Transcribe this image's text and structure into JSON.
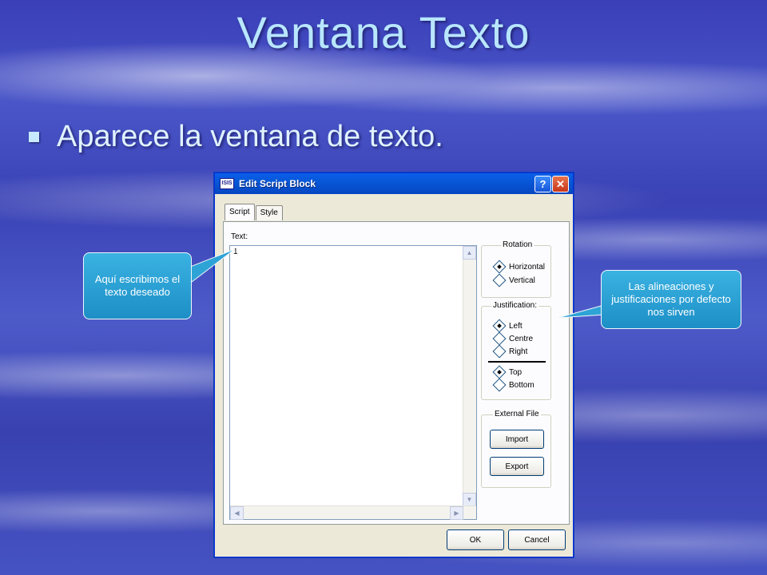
{
  "slide": {
    "title": "Ventana Texto",
    "bullet": "Aparece la ventana de texto."
  },
  "dialog": {
    "app_icon_text": "ISIS",
    "title": "Edit Script Block",
    "help_label": "?",
    "close_label": "✕",
    "tabs": [
      {
        "label": "Script",
        "active": true
      },
      {
        "label": "Style",
        "active": false
      }
    ],
    "text_label": "Text:",
    "text_value": "1",
    "rotation": {
      "title": "Rotation",
      "options": [
        {
          "label": "Horizontal",
          "checked": true
        },
        {
          "label": "Vertical",
          "checked": false
        }
      ]
    },
    "justification": {
      "title": "Justification:",
      "horizontal": [
        {
          "label": "Left",
          "checked": true
        },
        {
          "label": "Centre",
          "checked": false
        },
        {
          "label": "Right",
          "checked": false
        }
      ],
      "vertical": [
        {
          "label": "Top",
          "checked": true
        },
        {
          "label": "Bottom",
          "checked": false
        }
      ]
    },
    "external_file": {
      "title": "External File",
      "import_label": "Import",
      "export_label": "Export"
    },
    "ok_label": "OK",
    "cancel_label": "Cancel"
  },
  "callouts": {
    "left": "Aquí escribimos el texto deseado",
    "right": "Las alineaciones y justificaciones por defecto nos sirven"
  },
  "colors": {
    "callout": "#2ea3d6",
    "title_text": "#b8e6ff",
    "titlebar": "#0757d7"
  }
}
